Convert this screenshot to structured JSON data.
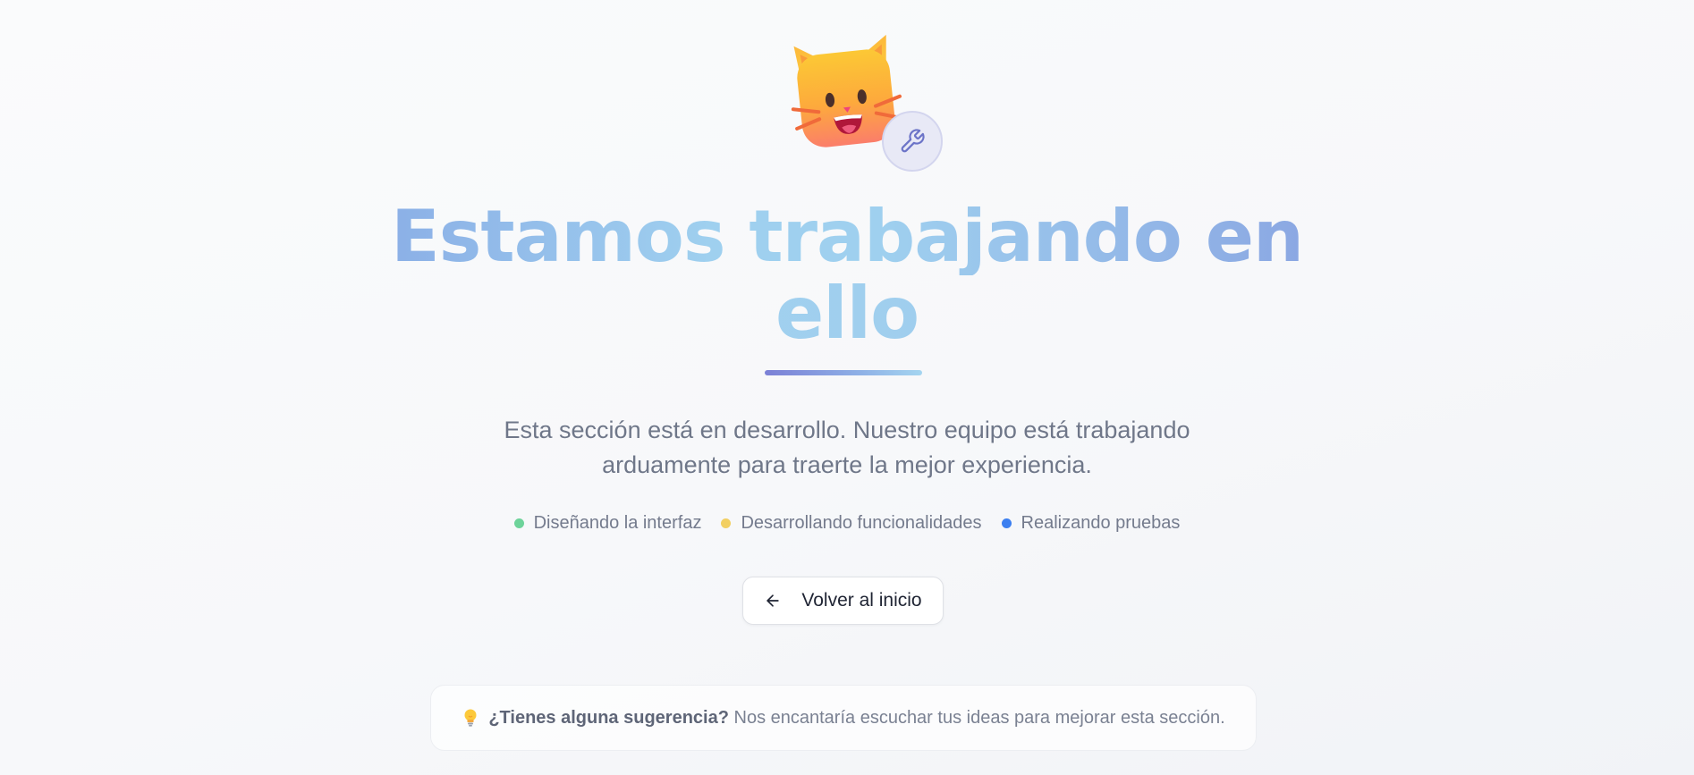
{
  "hero": {
    "illustration_icon": "cat-face-icon",
    "badge_icon": "wrench-icon"
  },
  "headline": {
    "line1_part1": "Estamos",
    "line1_part2": "trabajando en",
    "line2": "ello"
  },
  "description": {
    "line1": "Esta sección está en desarrollo. Nuestro equipo está trabajando",
    "line2": "arduamente para traerte la mejor experiencia."
  },
  "status_items": [
    {
      "label": "Diseñando la interfaz",
      "color": "#6dd39a"
    },
    {
      "label": "Desarrollando funcionalidades",
      "color": "#f2cf62"
    },
    {
      "label": "Realizando pruebas",
      "color": "#3c7ff0"
    }
  ],
  "back_button": {
    "label": "Volver al inicio",
    "icon": "arrow-left-icon"
  },
  "suggestion": {
    "icon": "light-bulb-icon",
    "bold_text": "¿Tienes alguna sugerencia?",
    "text": "Nos encantaría escuchar tus ideas para mejorar esta sección."
  }
}
